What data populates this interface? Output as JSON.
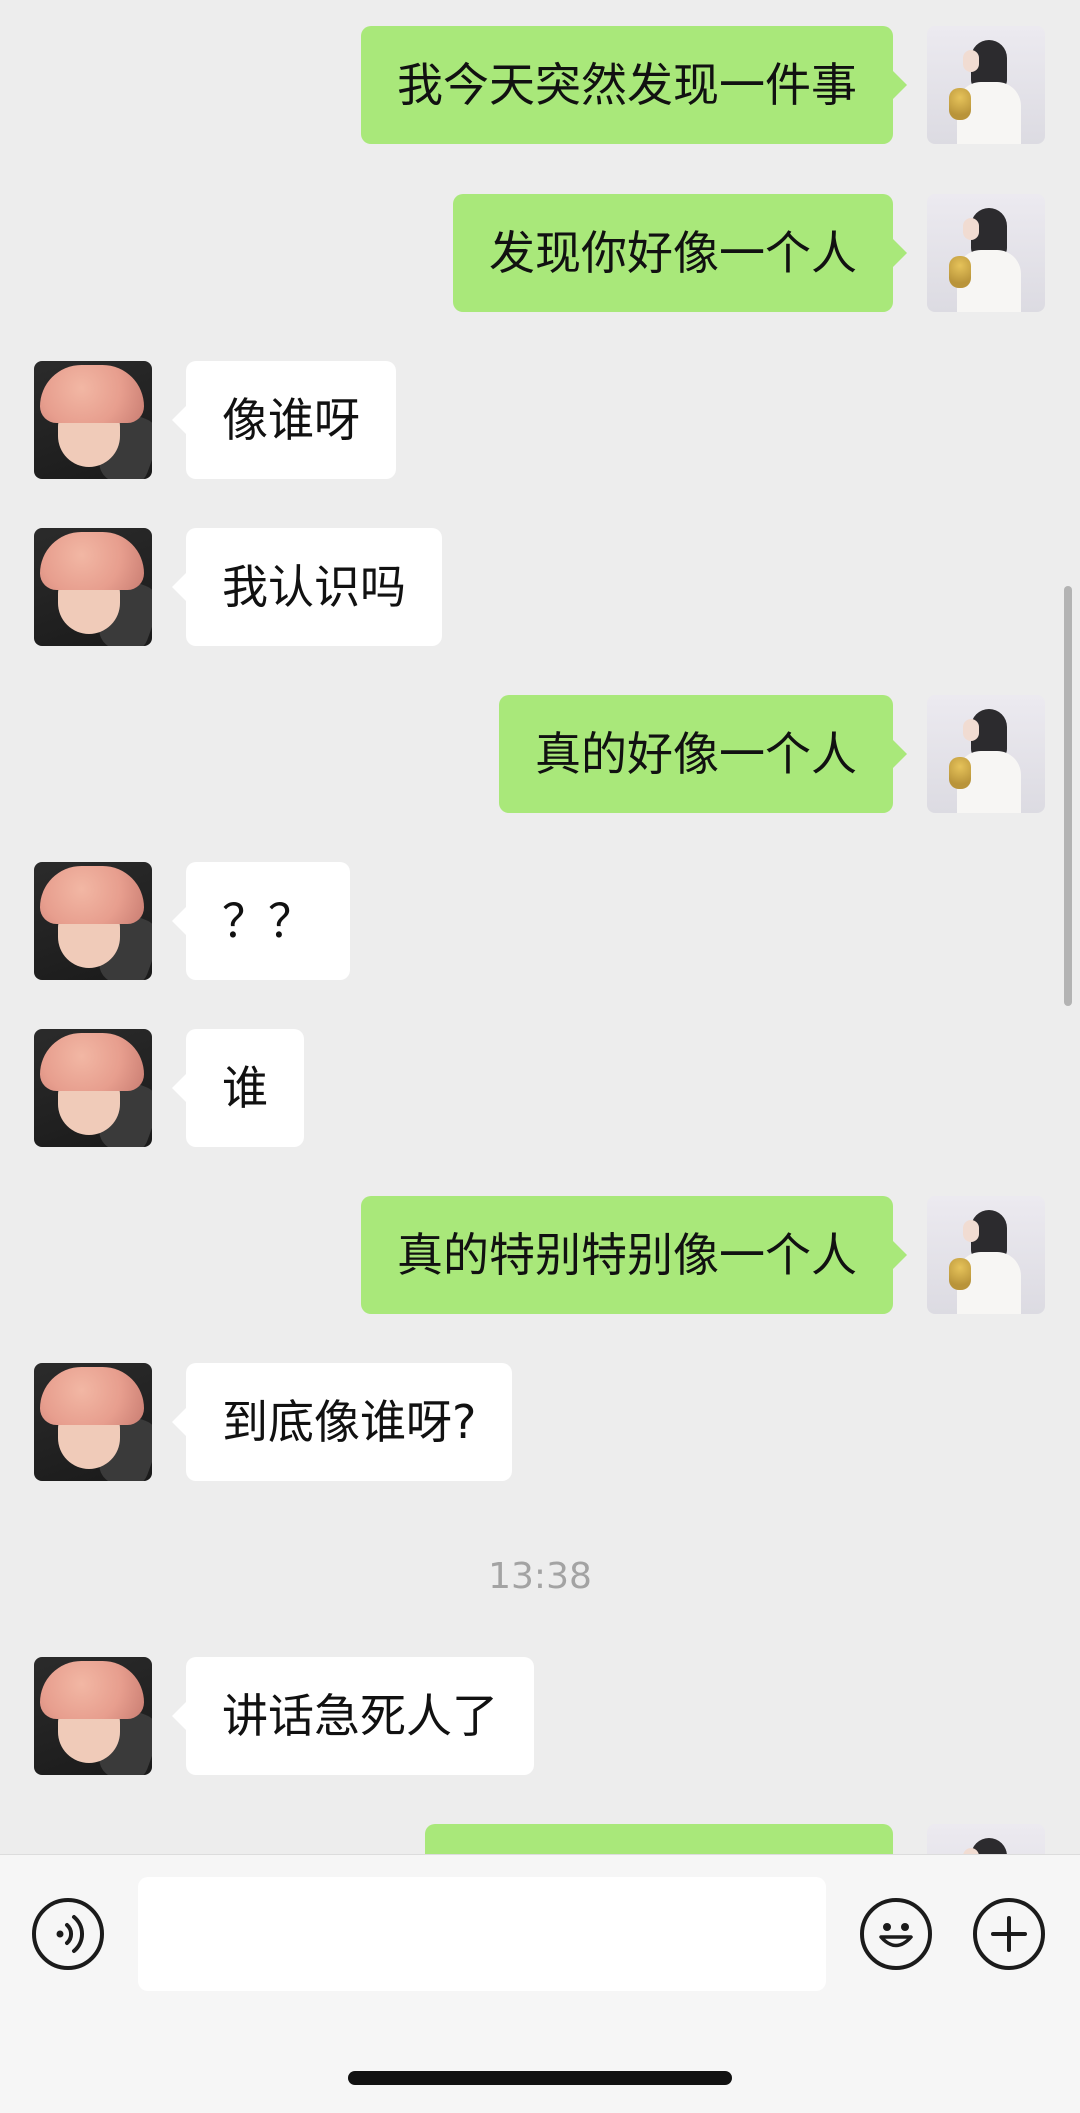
{
  "messages": [
    {
      "side": "right",
      "text": "我今天突然发现一件事"
    },
    {
      "side": "right",
      "text": "发现你好像一个人"
    },
    {
      "side": "left",
      "text": "像谁呀"
    },
    {
      "side": "left",
      "text": "我认识吗"
    },
    {
      "side": "right",
      "text": "真的好像一个人"
    },
    {
      "side": "left",
      "text": "？？"
    },
    {
      "side": "left",
      "text": "谁"
    },
    {
      "side": "right",
      "text": "真的特别特别像一个人"
    },
    {
      "side": "left",
      "text": "到底像谁呀?"
    },
    {
      "side": "left",
      "text": "讲话急死人了"
    },
    {
      "side": "right",
      "text": ""
    }
  ],
  "timestamp": "13:38",
  "input_bar": {
    "text_value": "",
    "icons": [
      "voice-icon",
      "emoji-icon",
      "plus-icon"
    ]
  },
  "colors": {
    "background": "#ededed",
    "sent_bubble": "#a9e87a",
    "received_bubble": "#ffffff",
    "timestamp": "#a3a3a3"
  }
}
